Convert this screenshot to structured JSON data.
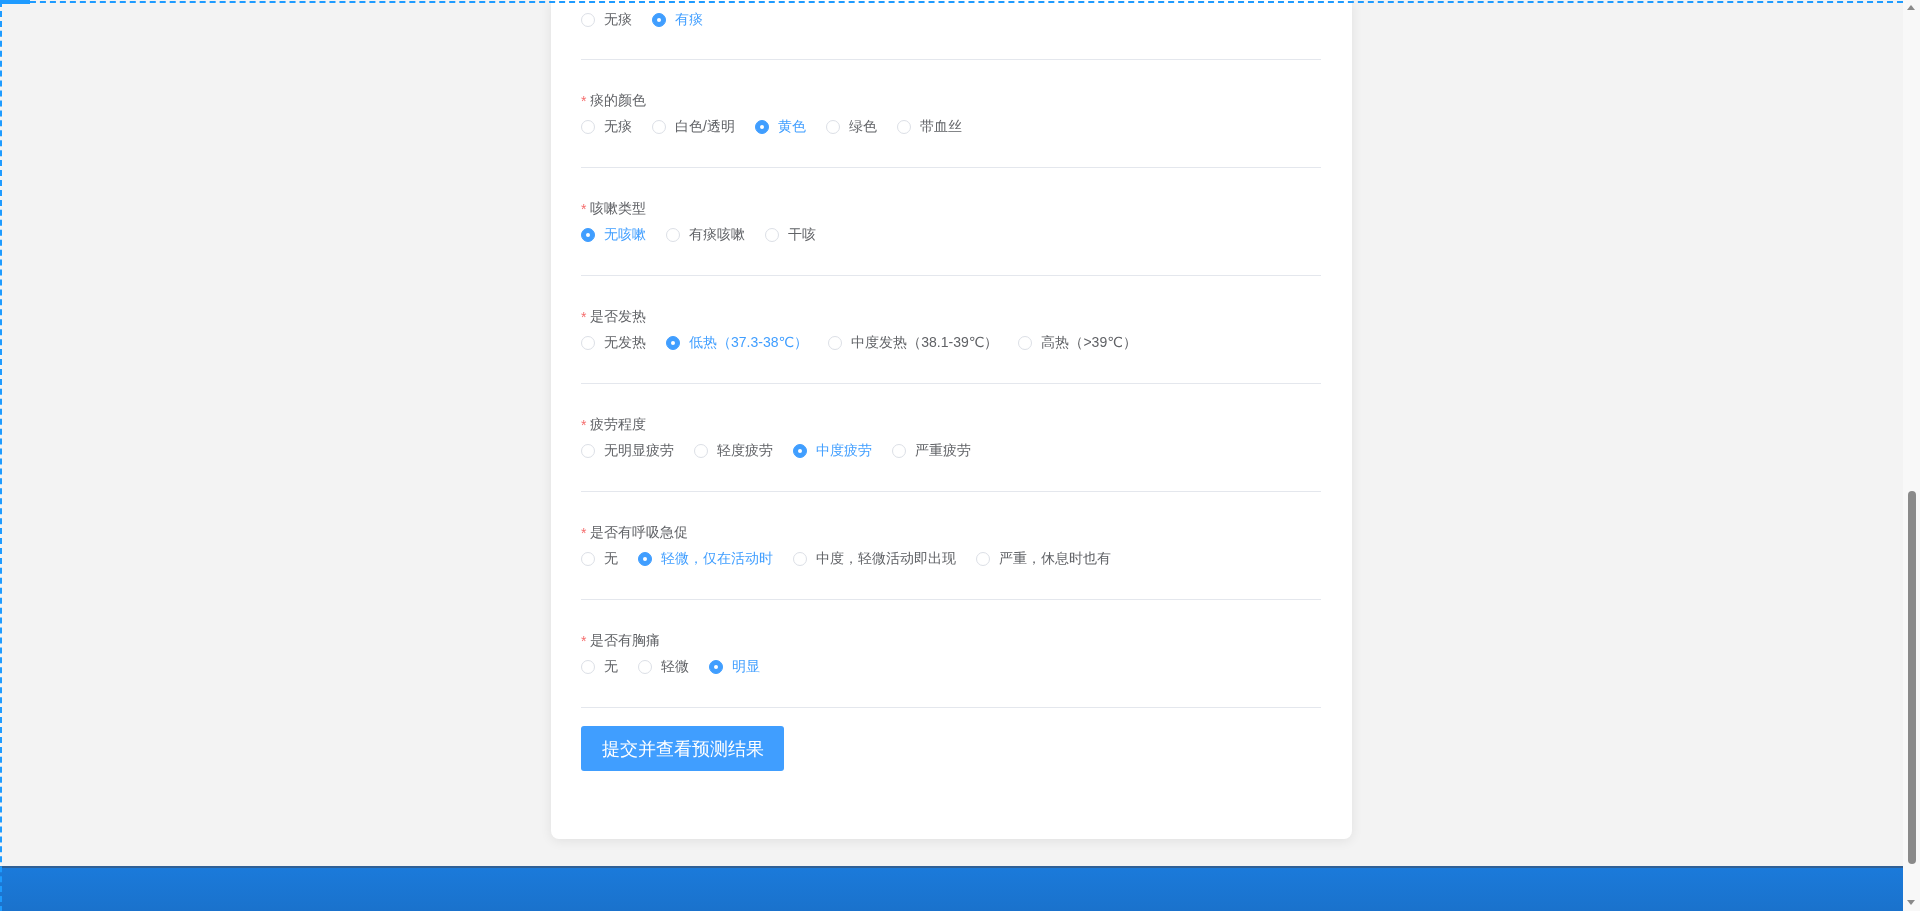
{
  "form": {
    "sections": [
      {
        "options": [
          {
            "label": "无痰",
            "selected": false
          },
          {
            "label": "有痰",
            "selected": true
          }
        ]
      },
      {
        "label": "痰的颜色",
        "required_mark": "*",
        "options": [
          {
            "label": "无痰",
            "selected": false
          },
          {
            "label": "白色/透明",
            "selected": false
          },
          {
            "label": "黄色",
            "selected": true
          },
          {
            "label": "绿色",
            "selected": false
          },
          {
            "label": "带血丝",
            "selected": false
          }
        ]
      },
      {
        "label": "咳嗽类型",
        "required_mark": "*",
        "options": [
          {
            "label": "无咳嗽",
            "selected": true
          },
          {
            "label": "有痰咳嗽",
            "selected": false
          },
          {
            "label": "干咳",
            "selected": false
          }
        ]
      },
      {
        "label": "是否发热",
        "required_mark": "*",
        "options": [
          {
            "label": "无发热",
            "selected": false
          },
          {
            "label": "低热（37.3-38℃）",
            "selected": true
          },
          {
            "label": "中度发热（38.1-39℃）",
            "selected": false
          },
          {
            "label": "高热（>39℃）",
            "selected": false
          }
        ]
      },
      {
        "label": "疲劳程度",
        "required_mark": "*",
        "options": [
          {
            "label": "无明显疲劳",
            "selected": false
          },
          {
            "label": "轻度疲劳",
            "selected": false
          },
          {
            "label": "中度疲劳",
            "selected": true
          },
          {
            "label": "严重疲劳",
            "selected": false
          }
        ]
      },
      {
        "label": "是否有呼吸急促",
        "required_mark": "*",
        "options": [
          {
            "label": "无",
            "selected": false
          },
          {
            "label": "轻微，仅在活动时",
            "selected": true
          },
          {
            "label": "中度，轻微活动即出现",
            "selected": false
          },
          {
            "label": "严重，休息时也有",
            "selected": false
          }
        ]
      },
      {
        "label": "是否有胸痛",
        "required_mark": "*",
        "options": [
          {
            "label": "无",
            "selected": false
          },
          {
            "label": "轻微",
            "selected": false
          },
          {
            "label": "明显",
            "selected": true
          }
        ]
      }
    ],
    "submit_button": "提交并查看预测结果"
  }
}
